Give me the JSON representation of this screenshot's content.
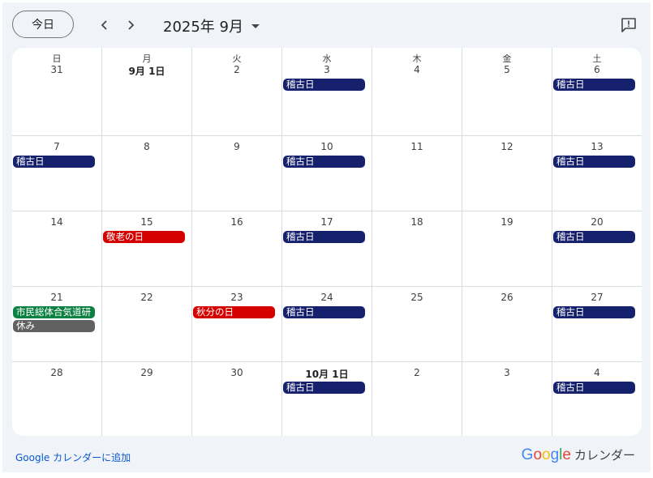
{
  "toolbar": {
    "today_label": "今日",
    "month_label": "2025年 9月"
  },
  "colors": {
    "稽古日": "#16216e",
    "holiday": "#d50000",
    "green": "#0b8043",
    "gray": "#616161"
  },
  "weekdays": [
    "日",
    "月",
    "火",
    "水",
    "木",
    "金",
    "土"
  ],
  "weeks": [
    [
      {
        "label": "31",
        "events": []
      },
      {
        "label": "9月 1日",
        "bold": true,
        "events": []
      },
      {
        "label": "2",
        "events": []
      },
      {
        "label": "3",
        "events": [
          {
            "title": "稽古日",
            "color": "#16216e"
          }
        ]
      },
      {
        "label": "4",
        "events": []
      },
      {
        "label": "5",
        "events": []
      },
      {
        "label": "6",
        "events": [
          {
            "title": "稽古日",
            "color": "#16216e"
          }
        ]
      }
    ],
    [
      {
        "label": "7",
        "events": [
          {
            "title": "稽古日",
            "color": "#16216e"
          }
        ]
      },
      {
        "label": "8",
        "events": []
      },
      {
        "label": "9",
        "events": []
      },
      {
        "label": "10",
        "events": [
          {
            "title": "稽古日",
            "color": "#16216e"
          }
        ]
      },
      {
        "label": "11",
        "events": []
      },
      {
        "label": "12",
        "events": []
      },
      {
        "label": "13",
        "events": [
          {
            "title": "稽古日",
            "color": "#16216e"
          }
        ]
      }
    ],
    [
      {
        "label": "14",
        "events": []
      },
      {
        "label": "15",
        "events": [
          {
            "title": "敬老の日",
            "color": "#d50000"
          }
        ]
      },
      {
        "label": "16",
        "events": []
      },
      {
        "label": "17",
        "events": [
          {
            "title": "稽古日",
            "color": "#16216e"
          }
        ]
      },
      {
        "label": "18",
        "events": []
      },
      {
        "label": "19",
        "events": []
      },
      {
        "label": "20",
        "events": [
          {
            "title": "稽古日",
            "color": "#16216e"
          }
        ]
      }
    ],
    [
      {
        "label": "21",
        "events": [
          {
            "title": "市民総体合気道研",
            "color": "#0b8043"
          },
          {
            "title": "休み",
            "color": "#616161"
          }
        ]
      },
      {
        "label": "22",
        "events": []
      },
      {
        "label": "23",
        "events": [
          {
            "title": "秋分の日",
            "color": "#d50000"
          }
        ]
      },
      {
        "label": "24",
        "events": [
          {
            "title": "稽古日",
            "color": "#16216e"
          }
        ]
      },
      {
        "label": "25",
        "events": []
      },
      {
        "label": "26",
        "events": []
      },
      {
        "label": "27",
        "events": [
          {
            "title": "稽古日",
            "color": "#16216e"
          }
        ]
      }
    ],
    [
      {
        "label": "28",
        "events": []
      },
      {
        "label": "29",
        "events": []
      },
      {
        "label": "30",
        "events": []
      },
      {
        "label": "10月 1日",
        "bold": true,
        "events": [
          {
            "title": "稽古日",
            "color": "#16216e"
          }
        ]
      },
      {
        "label": "2",
        "events": []
      },
      {
        "label": "3",
        "events": []
      },
      {
        "label": "4",
        "events": [
          {
            "title": "稽古日",
            "color": "#16216e"
          }
        ]
      }
    ]
  ],
  "footer": {
    "add_link": "Google カレンダーに追加",
    "brand_letters": [
      {
        "ch": "G",
        "color": "#4285f4"
      },
      {
        "ch": "o",
        "color": "#ea4335"
      },
      {
        "ch": "o",
        "color": "#fbbc05"
      },
      {
        "ch": "g",
        "color": "#4285f4"
      },
      {
        "ch": "l",
        "color": "#34a853"
      },
      {
        "ch": "e",
        "color": "#ea4335"
      }
    ],
    "brand_suffix": "カレンダー"
  }
}
